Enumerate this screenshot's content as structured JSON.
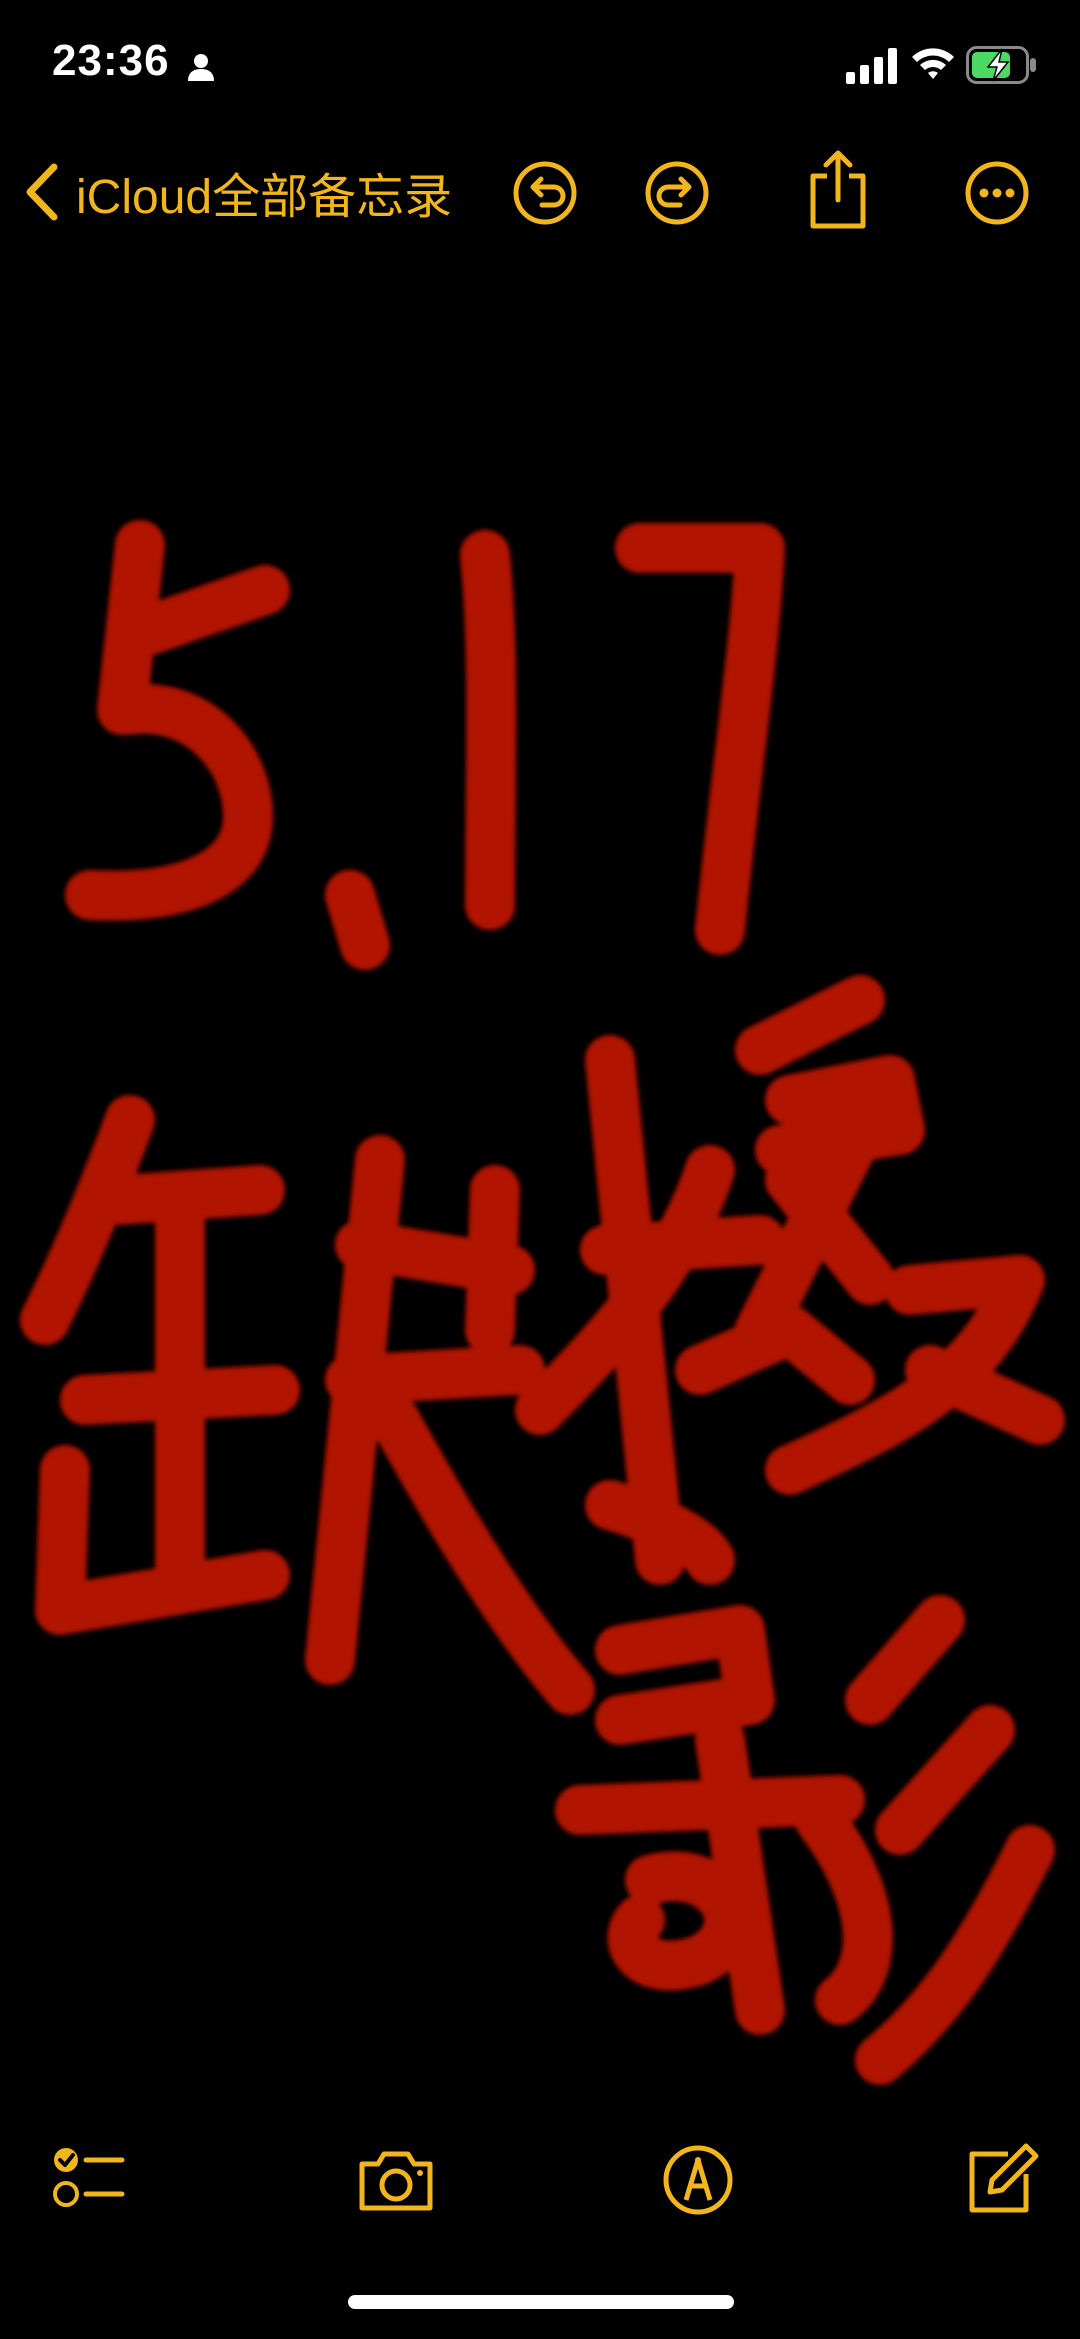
{
  "status_bar": {
    "time": "23:36",
    "icons": [
      "person-icon",
      "cellular-signal-icon",
      "wifi-icon",
      "battery-charging-icon"
    ],
    "battery_color": "#4cd964"
  },
  "nav": {
    "back_label": "iCloud全部备忘录",
    "icons": [
      "undo-icon",
      "redo-icon",
      "share-icon",
      "more-icon"
    ],
    "accent_color": "#f2b61c"
  },
  "drawing": {
    "description_icon": "handwritten-sketch",
    "ink_color": "#c01500"
  },
  "toolbar": {
    "icons": [
      "checklist-icon",
      "camera-icon",
      "markup-pen-icon",
      "compose-icon"
    ]
  }
}
